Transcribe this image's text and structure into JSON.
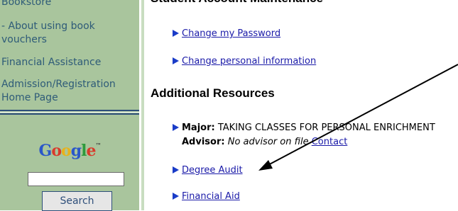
{
  "sidebar": {
    "bookstore": "Bookstore",
    "about_vouchers_line1": "- About using book",
    "about_vouchers_line2": "vouchers",
    "financial_assistance": "Financial Assistance",
    "admission_line1": "Admission/Registration",
    "admission_line2": "Home Page",
    "google_logo": "Google",
    "search_value": "",
    "search_button": "Search"
  },
  "main": {
    "top_heading": "Student Account Maintenance",
    "change_password": "Change my Password",
    "change_info": "Change personal information",
    "section_title": "Additional Resources",
    "major_label": "Major:",
    "major_value": "TAKING CLASSES FOR PERSONAL ENRICHMENT",
    "advisor_label": "Advisor:",
    "advisor_value": "No advisor on file",
    "contact_link": "Contact",
    "degree_audit": "Degree Audit",
    "financial_aid": "Financial Aid"
  },
  "colors": {
    "sidebar_bg": "#a9c59d",
    "sidebar_link": "#2e5b78",
    "link": "#1a1aa8",
    "bullet": "#1a3cc8"
  },
  "icons": [
    "triangle-bullet-icon",
    "annotation-arrow-icon"
  ]
}
